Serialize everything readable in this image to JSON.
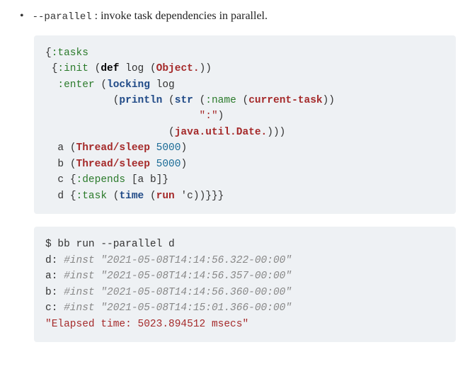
{
  "bullet": {
    "flag": "--parallel",
    "desc": ": invoke task dependencies in parallel."
  },
  "clj": {
    "l1": {
      "tasks": ":tasks"
    },
    "l2": {
      "init": ":init",
      "def": "def",
      "log": "log",
      "object": "Object."
    },
    "l3": {
      "enter": ":enter",
      "locking": "locking",
      "log": "log"
    },
    "l4": {
      "println": "println",
      "str": "str",
      "name": ":name",
      "current_task": "current-task"
    },
    "l5": {
      "colon_str": "\":\""
    },
    "l6": {
      "date": "java.util.Date."
    },
    "l7": {
      "a": "a",
      "thread_sleep": "Thread/sleep",
      "n": "5000"
    },
    "l8": {
      "b": "b",
      "thread_sleep": "Thread/sleep",
      "n": "5000"
    },
    "l9": {
      "c": "c",
      "depends": ":depends",
      "deps": "[a b]"
    },
    "l10": {
      "d": "d",
      "task": ":task",
      "time": "time",
      "run": "run",
      "q": "'c"
    }
  },
  "shell": {
    "prompt": "$",
    "cmd": "bb run --parallel d",
    "out_d": "d:",
    "ts_d": "#inst \"2021-05-08T14:14:56.322-00:00\"",
    "out_a": "a:",
    "ts_a": "#inst \"2021-05-08T14:14:56.357-00:00\"",
    "out_b": "b:",
    "ts_b": "#inst \"2021-05-08T14:14:56.360-00:00\"",
    "out_c": "c:",
    "ts_c": "#inst \"2021-05-08T14:15:01.366-00:00\"",
    "elapsed": "\"Elapsed time: 5023.894512 msecs\""
  }
}
